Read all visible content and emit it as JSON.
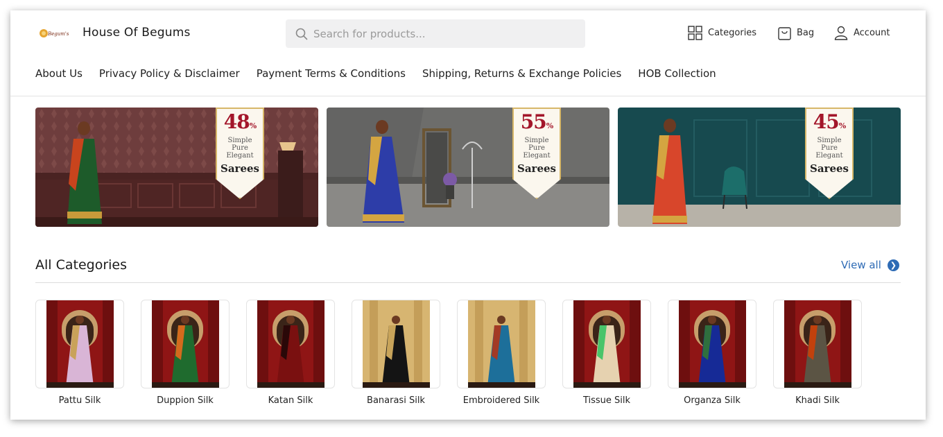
{
  "header": {
    "brand": "House Of Begums",
    "search_placeholder": "Search for products...",
    "actions": {
      "categories": "Categories",
      "bag": "Bag",
      "account": "Account"
    }
  },
  "nav": {
    "items": [
      "About Us",
      "Privacy Policy & Disclaimer",
      "Payment Terms & Conditions",
      "Shipping, Returns & Exchange Policies",
      "HOB Collection"
    ]
  },
  "banners": [
    {
      "discount": "48",
      "off": "%",
      "off_word": "OFF",
      "line1": "Simple",
      "line2": "Pure",
      "line3": "Elegant",
      "product": "Sarees"
    },
    {
      "discount": "55",
      "off": "%",
      "off_word": "OFF",
      "line1": "Simple",
      "line2": "Pure",
      "line3": "Elegant",
      "product": "Sarees"
    },
    {
      "discount": "45",
      "off": "%",
      "off_word": "OFF",
      "line1": "Simple",
      "line2": "Pure",
      "line3": "Elegant",
      "product": "Sarees"
    }
  ],
  "categories_section": {
    "title": "All Categories",
    "view_all": "View all",
    "items": [
      {
        "label": "Pattu Silk",
        "saree_color": "#d9b5d6",
        "accent": "#c9a25a",
        "backdrop": "#8f1515"
      },
      {
        "label": "Duppion Silk",
        "saree_color": "#1f6b2e",
        "accent": "#d46a1d",
        "backdrop": "#8f1515"
      },
      {
        "label": "Katan Silk",
        "saree_color": "#7a1010",
        "accent": "#2a0808",
        "backdrop": "#8f1515"
      },
      {
        "label": "Banarasi Silk",
        "saree_color": "#141414",
        "accent": "#c8a45a",
        "backdrop": "#c9a45c"
      },
      {
        "label": "Embroidered Silk",
        "saree_color": "#1d6f9a",
        "accent": "#a33a25",
        "backdrop": "#c9a45c"
      },
      {
        "label": "Tissue Silk",
        "saree_color": "#e6d2b0",
        "accent": "#49c46a",
        "backdrop": "#8f1515"
      },
      {
        "label": "Organza Silk",
        "saree_color": "#162a96",
        "accent": "#2f6f3e",
        "backdrop": "#8f1515"
      },
      {
        "label": "Khadi Silk",
        "saree_color": "#5b5444",
        "accent": "#c2410c",
        "backdrop": "#8f1515"
      }
    ]
  },
  "colors": {
    "accent_blue": "#2e6bb5",
    "discount_red": "#a3162a",
    "search_bg": "#f0f0f1"
  }
}
